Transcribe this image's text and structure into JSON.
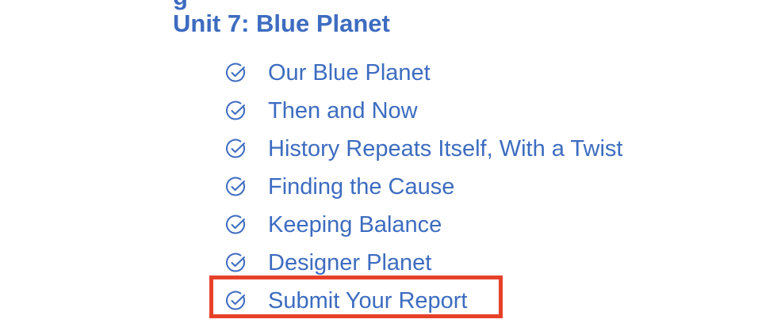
{
  "unit": {
    "title": "Unit 7: Blue Planet"
  },
  "lessons": [
    {
      "label": "Our Blue Planet",
      "icon": "check-circle-icon"
    },
    {
      "label": "Then and Now",
      "icon": "check-circle-icon"
    },
    {
      "label": "History Repeats Itself, With a Twist",
      "icon": "check-circle-icon"
    },
    {
      "label": "Finding the Cause",
      "icon": "check-circle-icon"
    },
    {
      "label": "Keeping Balance",
      "icon": "check-circle-icon"
    },
    {
      "label": "Designer Planet",
      "icon": "check-circle-icon"
    },
    {
      "label": "Submit Your Report",
      "icon": "check-circle-icon",
      "highlighted": true
    }
  ],
  "colors": {
    "link": "#3d6cc0",
    "highlight": "#e8412a"
  }
}
